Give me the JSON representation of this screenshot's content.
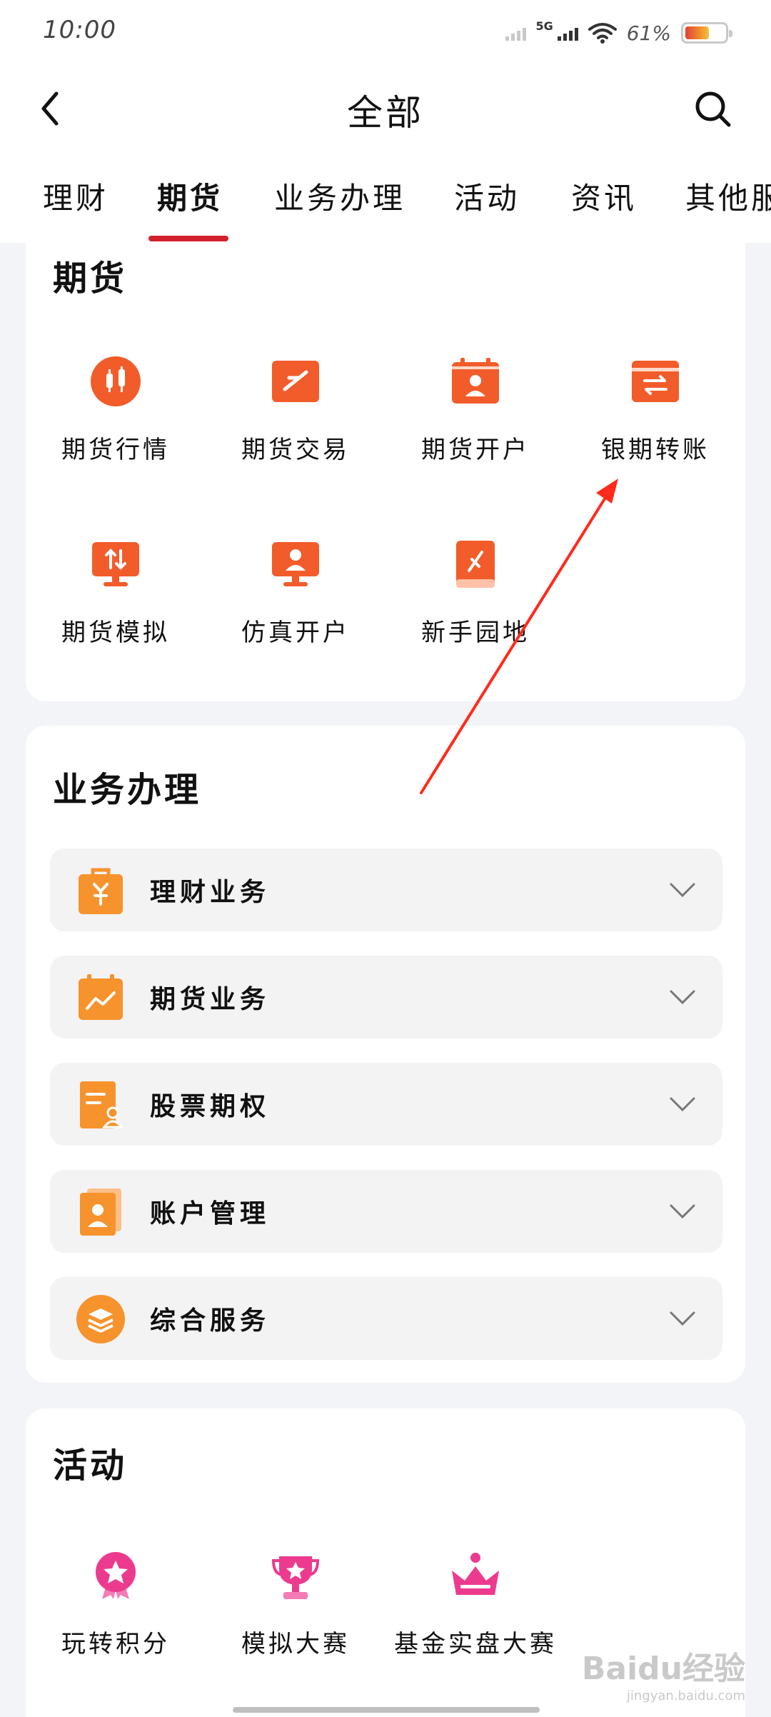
{
  "status_bar": {
    "time": "10:00",
    "network": "5G",
    "battery": "61%",
    "battery_level": 0.61
  },
  "header": {
    "title": "全部"
  },
  "tabs": [
    {
      "label": "理财"
    },
    {
      "label": "期货"
    },
    {
      "label": "业务办理"
    },
    {
      "label": "活动"
    },
    {
      "label": "资讯"
    },
    {
      "label": "其他服务"
    }
  ],
  "futures": {
    "title": "期货",
    "items": [
      {
        "label": "期货行情",
        "icon": "candlestick-icon"
      },
      {
        "label": "期货交易",
        "icon": "trade-icon"
      },
      {
        "label": "期货开户",
        "icon": "account-open-icon"
      },
      {
        "label": "银期转账",
        "icon": "transfer-icon"
      },
      {
        "label": "期货模拟",
        "icon": "simulation-icon"
      },
      {
        "label": "仿真开户",
        "icon": "sim-account-icon"
      },
      {
        "label": "新手园地",
        "icon": "book-icon"
      }
    ]
  },
  "business": {
    "title": "业务办理",
    "items": [
      {
        "label": "理财业务",
        "icon": "wealth-bag-icon"
      },
      {
        "label": "期货业务",
        "icon": "futures-calendar-icon"
      },
      {
        "label": "股票期权",
        "icon": "stock-option-icon"
      },
      {
        "label": "账户管理",
        "icon": "account-card-icon"
      },
      {
        "label": "综合服务",
        "icon": "layers-icon"
      }
    ]
  },
  "activity": {
    "title": "活动",
    "items": [
      {
        "label": "玩转积分",
        "icon": "medal-icon"
      },
      {
        "label": "模拟大赛",
        "icon": "trophy-icon"
      },
      {
        "label": "基金实盘大赛",
        "icon": "crown-icon"
      }
    ]
  },
  "watermark": {
    "brand": "Baidu经验",
    "site": "jingyan.baidu.com"
  },
  "colors": {
    "accent": "#d41f2d",
    "icon_orange": "#f25c2a",
    "icon_light_orange": "#f7932c",
    "icon_pink": "#ec3b8f"
  }
}
